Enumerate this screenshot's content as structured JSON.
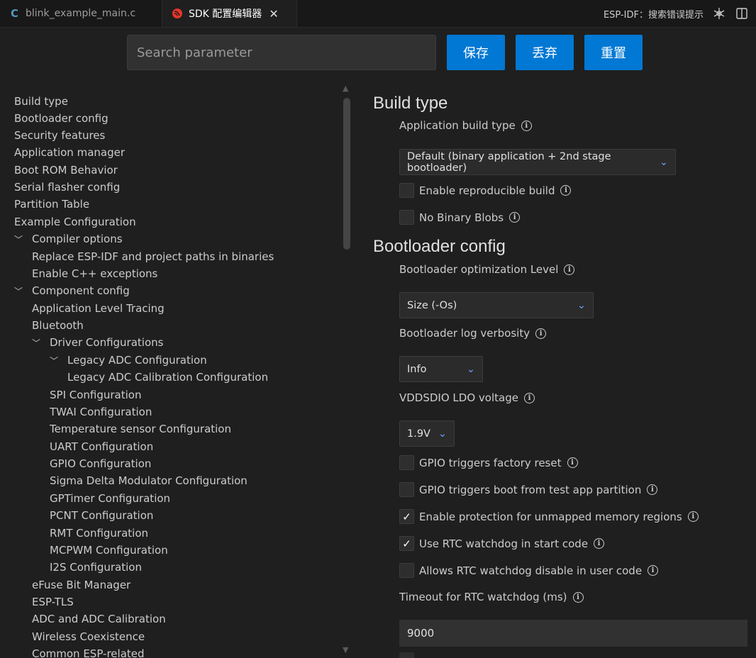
{
  "tabs": [
    {
      "label": "blink_example_main.c",
      "icon": "c-file-icon"
    },
    {
      "label": "SDK 配置编辑器",
      "icon": "espressif-icon",
      "close": "✕"
    }
  ],
  "top_right": {
    "label": "ESP-IDF：搜索错误提示"
  },
  "toolbar": {
    "search_placeholder": "Search parameter",
    "save_label": "保存",
    "discard_label": "丢弃",
    "reset_label": "重置"
  },
  "tree": [
    {
      "label": "Build type"
    },
    {
      "label": "Bootloader config"
    },
    {
      "label": "Security features"
    },
    {
      "label": "Application manager"
    },
    {
      "label": "Boot ROM Behavior"
    },
    {
      "label": "Serial flasher config"
    },
    {
      "label": "Partition Table"
    },
    {
      "label": "Example Configuration"
    },
    {
      "label": "Compiler options"
    },
    {
      "label": "Replace ESP-IDF and project paths in binaries"
    },
    {
      "label": "Enable C++ exceptions"
    },
    {
      "label": "Component config"
    },
    {
      "label": "Application Level Tracing"
    },
    {
      "label": "Bluetooth"
    },
    {
      "label": "Driver Configurations"
    },
    {
      "label": "Legacy ADC Configuration"
    },
    {
      "label": "Legacy ADC Calibration Configuration"
    },
    {
      "label": "SPI Configuration"
    },
    {
      "label": "TWAI Configuration"
    },
    {
      "label": "Temperature sensor Configuration"
    },
    {
      "label": "UART Configuration"
    },
    {
      "label": "GPIO Configuration"
    },
    {
      "label": "Sigma Delta Modulator Configuration"
    },
    {
      "label": "GPTimer Configuration"
    },
    {
      "label": "PCNT Configuration"
    },
    {
      "label": "RMT Configuration"
    },
    {
      "label": "MCPWM Configuration"
    },
    {
      "label": "I2S Configuration"
    },
    {
      "label": "eFuse Bit Manager"
    },
    {
      "label": "ESP-TLS"
    },
    {
      "label": "ADC and ADC Calibration"
    },
    {
      "label": "Wireless Coexistence"
    },
    {
      "label": "Common ESP-related"
    }
  ],
  "build_type": {
    "title": "Build type",
    "app_build_type_label": "Application build type",
    "app_build_type_value": "Default (binary application + 2nd stage bootloader)",
    "reproducible_label": "Enable reproducible build",
    "reproducible_checked": false,
    "no_blobs_label": "No Binary Blobs",
    "no_blobs_checked": false
  },
  "bootloader": {
    "title": "Bootloader config",
    "opt_level_label": "Bootloader optimization Level",
    "opt_level_value": "Size (-Os)",
    "log_label": "Bootloader log verbosity",
    "log_value": "Info",
    "vddsdio_label": "VDDSDIO LDO voltage",
    "vddsdio_value": "1.9V",
    "checks": [
      {
        "label": "GPIO triggers factory reset",
        "checked": false
      },
      {
        "label": "GPIO triggers boot from test app partition",
        "checked": false
      },
      {
        "label": "Enable protection for unmapped memory regions",
        "checked": true
      },
      {
        "label": "Use RTC watchdog in start code",
        "checked": true
      },
      {
        "label": "Allows RTC watchdog disable in user code",
        "checked": false
      }
    ],
    "rtc_timeout_label": "Timeout for RTC watchdog (ms)",
    "rtc_timeout_value": "9000"
  },
  "check_glyph": "✓",
  "dropdown_glyph": "⌄",
  "info_glyph": "i",
  "colors": {
    "accent": "#0078d4",
    "background": "#1f1f1f",
    "dropdown": "#6b9cff"
  }
}
